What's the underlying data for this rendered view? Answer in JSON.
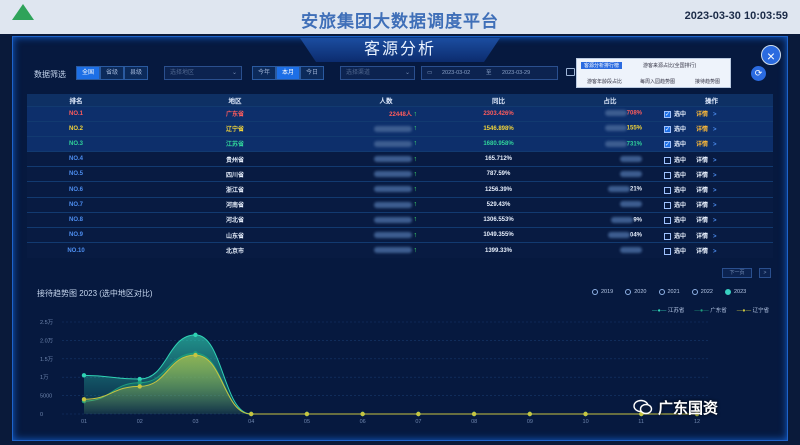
{
  "header": {
    "title": "安旅集团大数据调度平台",
    "datetime": "2023-03-30  10:03:59"
  },
  "modal": {
    "title": "客源分析",
    "close_label": "×"
  },
  "filter": {
    "label": "数据筛选",
    "scope_tabs": [
      "全国",
      "省级",
      "县级"
    ],
    "region_placeholder": "选择地区",
    "period_tabs": [
      "今年",
      "本月",
      "今日"
    ],
    "period_selected": "本月",
    "channel_placeholder": "选择渠道",
    "date_from": "2023-03-02",
    "date_sep": "至",
    "date_to": "2023-03-29",
    "popup_items": [
      "客源分析排行榜",
      "游客来源占比(全国排行)",
      "游客年龄段占比",
      "每周入园趋势图",
      "接待趋势图"
    ],
    "refresh_label": "⟳"
  },
  "table": {
    "headers": [
      "排名",
      "地区",
      "人数",
      "同比",
      "占比",
      "操作"
    ],
    "select_label": "选中",
    "detail_label": "详情",
    "rows": [
      {
        "rank": "NO.1",
        "region": "广东省",
        "people": "22448人",
        "yoy": "2303.426%",
        "share": "708%",
        "checked": true,
        "color": "#ff5c5c"
      },
      {
        "rank": "NO.2",
        "region": "辽宁省",
        "people": "",
        "yoy": "1546.898%",
        "share": "155%",
        "checked": true,
        "color": "#f2d43a"
      },
      {
        "rank": "NO.3",
        "region": "江苏省",
        "people": "",
        "yoy": "1680.958%",
        "share": "731%",
        "checked": true,
        "color": "#31d39a"
      },
      {
        "rank": "NO.4",
        "region": "贵州省",
        "people": "",
        "yoy": "165.712%",
        "share": "",
        "checked": false,
        "color": "#4d8ef0"
      },
      {
        "rank": "NO.5",
        "region": "四川省",
        "people": "",
        "yoy": "787.59%",
        "share": "",
        "checked": false,
        "color": "#4d8ef0"
      },
      {
        "rank": "NO.6",
        "region": "浙江省",
        "people": "",
        "yoy": "1256.39%",
        "share": "21%",
        "checked": false,
        "color": "#4d8ef0"
      },
      {
        "rank": "NO.7",
        "region": "河南省",
        "people": "",
        "yoy": "529.43%",
        "share": "",
        "checked": false,
        "color": "#4d8ef0"
      },
      {
        "rank": "NO.8",
        "region": "河北省",
        "people": "",
        "yoy": "1306.553%",
        "share": "9%",
        "checked": false,
        "color": "#4d8ef0"
      },
      {
        "rank": "NO.9",
        "region": "山东省",
        "people": "",
        "yoy": "1049.355%",
        "share": "04%",
        "checked": false,
        "color": "#4d8ef0"
      },
      {
        "rank": "NO.10",
        "region": "北京市",
        "people": "",
        "yoy": "1399.33%",
        "share": "",
        "checked": false,
        "color": "#4d8ef0"
      }
    ],
    "pager_next": "下一页",
    "pager_arrow": ">"
  },
  "trend": {
    "title": "接待趋势图 2023 (选中地区对比)",
    "years": [
      "2019",
      "2020",
      "2021",
      "2022",
      "2023"
    ],
    "year_selected": "2023"
  },
  "chart_data": {
    "type": "line",
    "x": [
      "01",
      "02",
      "03",
      "04",
      "05",
      "06",
      "07",
      "08",
      "09",
      "10",
      "11",
      "12"
    ],
    "ylim": [
      0,
      25000
    ],
    "yticks": [
      "2.5万",
      "2.0万",
      "1.5万",
      "1万",
      "5000",
      "0"
    ],
    "series": [
      {
        "name": "江苏省",
        "color": "#2fd3b4",
        "values": [
          10500,
          9500,
          21500,
          0,
          0,
          0,
          0,
          0,
          0,
          0,
          0,
          0
        ]
      },
      {
        "name": "广东省",
        "color": "#1f9e7c",
        "values": [
          3500,
          8500,
          16500,
          0,
          0,
          0,
          0,
          0,
          0,
          0,
          0,
          0
        ]
      },
      {
        "name": "辽宁省",
        "color": "#c8c440",
        "values": [
          4000,
          7500,
          16000,
          0,
          0,
          0,
          0,
          0,
          0,
          0,
          0,
          0
        ]
      }
    ],
    "legend": "top-right",
    "grid": true
  },
  "watermark": {
    "text": "广东国资"
  }
}
